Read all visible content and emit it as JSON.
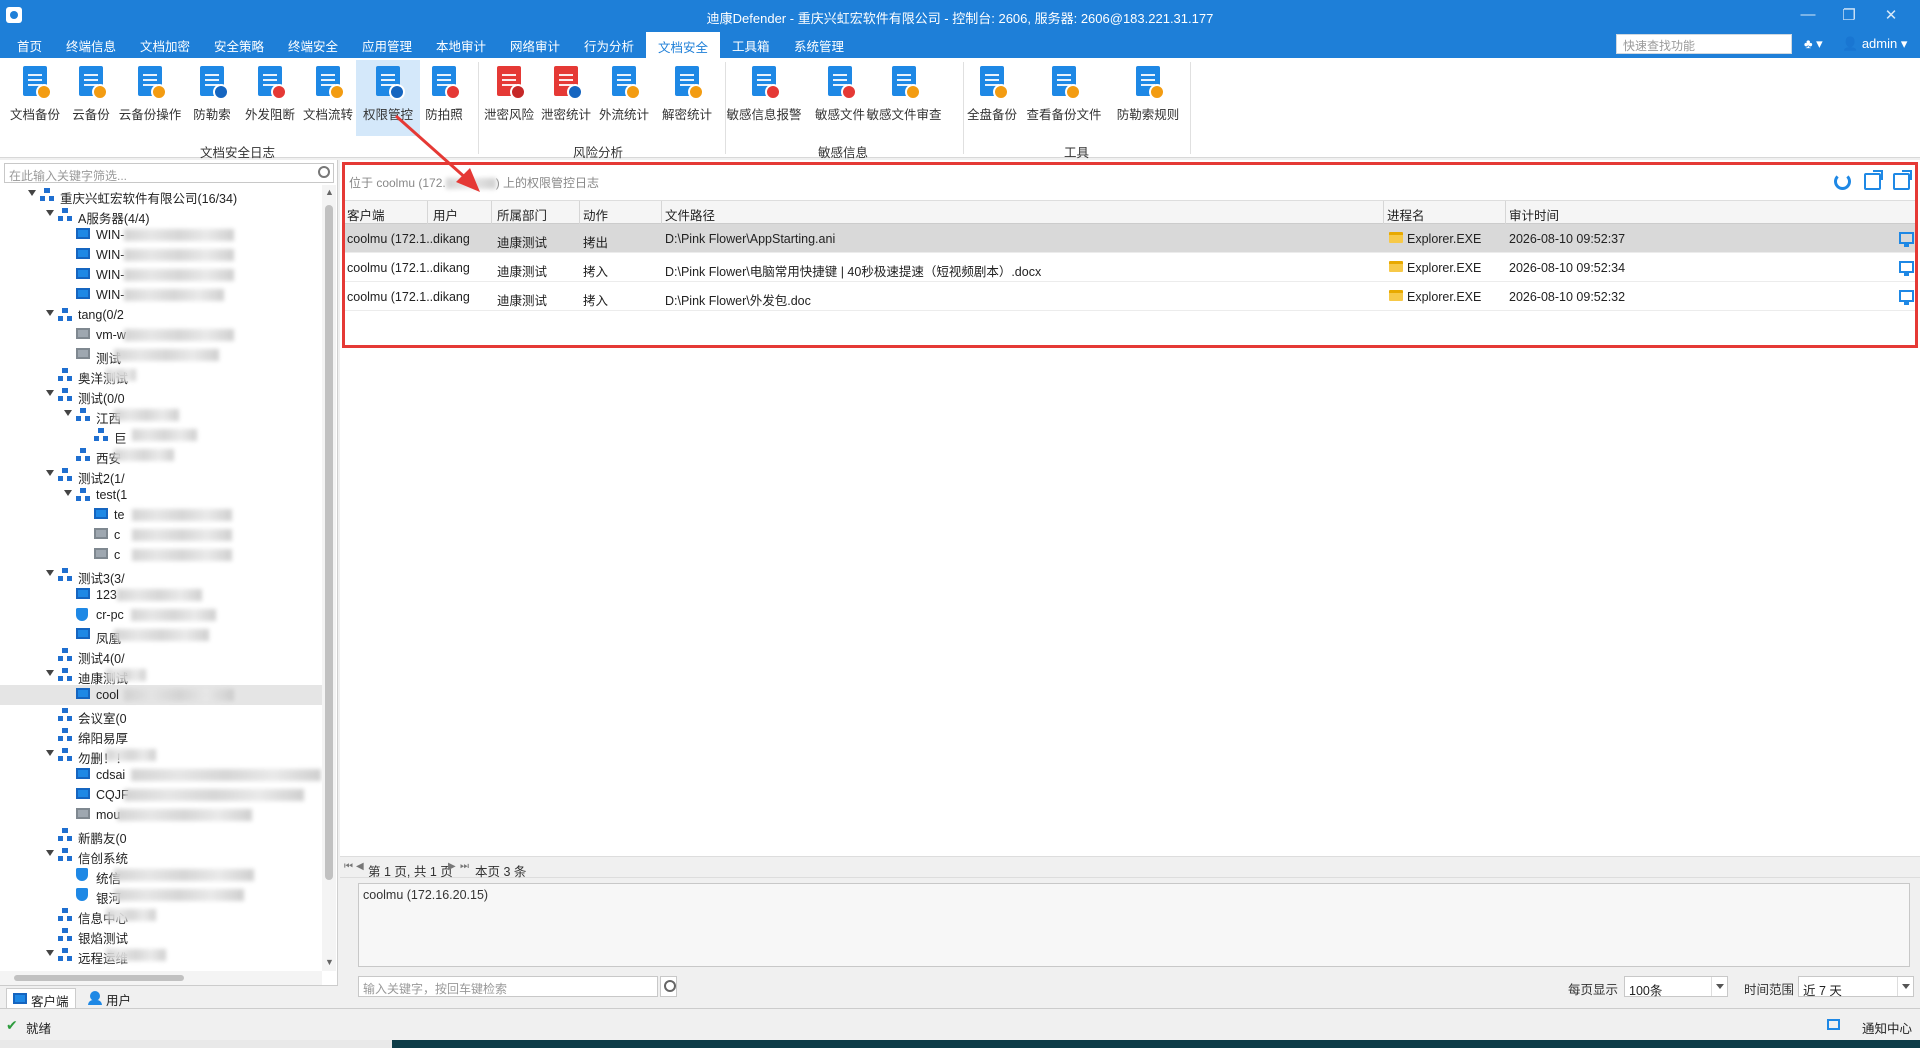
{
  "window": {
    "title": "迪康Defender - 重庆兴虹宏软件有限公司 - 控制台: 2606, 服务器: 2606@183.221.31.177",
    "controls": [
      "—",
      "❐",
      "✕"
    ]
  },
  "menu": {
    "items": [
      "首页",
      "终端信息",
      "文档加密",
      "安全策略",
      "终端安全",
      "应用管理",
      "本地审计",
      "网络审计",
      "行为分析",
      "文档安全",
      "工具箱",
      "系统管理"
    ],
    "active": "文档安全",
    "quick_search_placeholder": "快速查找功能",
    "admin_label": "admin",
    "org_menu": "▾"
  },
  "ribbon": {
    "buttons": [
      {
        "label": "文档备份",
        "icon": "doc-backup-icon",
        "color": "#1e88e5",
        "badge": "#f39c12"
      },
      {
        "label": "云备份",
        "icon": "cloud-backup-icon",
        "color": "#1e88e5",
        "badge": "#f39c12"
      },
      {
        "label": "云备份操作",
        "icon": "cloud-backup-op-icon",
        "color": "#1e88e5",
        "badge": "#f39c12"
      },
      {
        "label": "防勒索",
        "icon": "anti-ransom-icon",
        "color": "#1e88e5",
        "badge": "#1565c0"
      },
      {
        "label": "外发阻断",
        "icon": "send-block-icon",
        "color": "#1e88e5",
        "badge": "#e53935"
      },
      {
        "label": "文档流转",
        "icon": "doc-flow-icon",
        "color": "#1e88e5",
        "badge": "#f39c12"
      },
      {
        "label": "权限管控",
        "icon": "permission-control-icon",
        "color": "#1e88e5",
        "badge": "#1565c0"
      },
      {
        "label": "防拍照",
        "icon": "anti-photo-icon",
        "color": "#1e88e5",
        "badge": "#e53935"
      },
      {
        "label": "泄密风险",
        "icon": "leak-risk-icon",
        "color": "#e53935",
        "badge": "#c62828"
      },
      {
        "label": "泄密统计",
        "icon": "leak-stats-icon",
        "color": "#e53935",
        "badge": "#1565c0"
      },
      {
        "label": "外流统计",
        "icon": "outflow-stats-icon",
        "color": "#1e88e5",
        "badge": "#f39c12"
      },
      {
        "label": "解密统计",
        "icon": "decrypt-stats-icon",
        "color": "#1e88e5",
        "badge": "#f39c12"
      },
      {
        "label": "敏感信息报警",
        "icon": "sensitive-alarm-icon",
        "color": "#1e88e5",
        "badge": "#e53935"
      },
      {
        "label": "敏感文件",
        "icon": "sensitive-file-icon",
        "color": "#1e88e5",
        "badge": "#e53935"
      },
      {
        "label": "敏感文件审查",
        "icon": "sensitive-review-icon",
        "color": "#1e88e5",
        "badge": "#f39c12"
      },
      {
        "label": "全盘备份",
        "icon": "full-backup-icon",
        "color": "#1e88e5",
        "badge": "#f39c12"
      },
      {
        "label": "查看备份文件",
        "icon": "view-backup-icon",
        "color": "#1e88e5",
        "badge": "#f39c12"
      },
      {
        "label": "防勒索规则",
        "icon": "anti-ransom-rule-icon",
        "color": "#1e88e5",
        "badge": "#f39c12"
      }
    ],
    "groups": [
      "文档安全日志",
      "风险分析",
      "敏感信息",
      "工具"
    ],
    "active": "权限管控"
  },
  "left": {
    "filter_placeholder": "在此输入关键字筛选...",
    "tree": [
      {
        "text": "重庆兴虹宏软件有限公司(16/34)",
        "type": "org"
      },
      {
        "text": "A服务器(4/4)",
        "type": "org"
      },
      {
        "text": "WIN-",
        "type": "pc"
      },
      {
        "text": "WIN-",
        "type": "pc"
      },
      {
        "text": "WIN-",
        "type": "pc"
      },
      {
        "text": "WIN-",
        "type": "pc"
      },
      {
        "text": "tang(0/2",
        "type": "org"
      },
      {
        "text": "vm-w",
        "type": "pc-off"
      },
      {
        "text": "测试",
        "type": "pc-off"
      },
      {
        "text": "奥洋测试",
        "type": "org"
      },
      {
        "text": "测试(0/0",
        "type": "org"
      },
      {
        "text": "江西",
        "type": "org"
      },
      {
        "text": "巨",
        "type": "org"
      },
      {
        "text": "西安",
        "type": "org"
      },
      {
        "text": "测试2(1/",
        "type": "org"
      },
      {
        "text": "test(1",
        "type": "org"
      },
      {
        "text": "te",
        "type": "pc"
      },
      {
        "text": "c",
        "type": "pc-off"
      },
      {
        "text": "c",
        "type": "pc-off"
      },
      {
        "text": "测试3(3/",
        "type": "org"
      },
      {
        "text": "123",
        "type": "pc"
      },
      {
        "text": "cr-pc",
        "type": "shield"
      },
      {
        "text": "凤凰",
        "type": "pc"
      },
      {
        "text": "测试4(0/",
        "type": "org"
      },
      {
        "text": "迪康测试",
        "type": "org"
      },
      {
        "text": "cool",
        "type": "pc"
      },
      {
        "text": "会议室(0",
        "type": "org"
      },
      {
        "text": "绵阳易厚",
        "type": "org"
      },
      {
        "text": "勿删！！",
        "type": "org"
      },
      {
        "text": "cdsai",
        "type": "pc"
      },
      {
        "text": "CQJF",
        "type": "pc"
      },
      {
        "text": "mou",
        "type": "pc-off"
      },
      {
        "text": "新鹏友(0",
        "type": "org"
      },
      {
        "text": "信创系统",
        "type": "org"
      },
      {
        "text": "统信",
        "type": "shield"
      },
      {
        "text": "银河",
        "type": "shield"
      },
      {
        "text": "信息中心",
        "type": "org"
      },
      {
        "text": "银焰测试",
        "type": "org"
      },
      {
        "text": "远程运维",
        "type": "org"
      }
    ],
    "tabs": [
      "客户端",
      "用户"
    ]
  },
  "main": {
    "title_prefix": "位于 coolmu (172.",
    "title_suffix": ") 上的权限管控日志",
    "columns": [
      "客户端",
      "用户",
      "所属部门",
      "动作",
      "文件路径",
      "进程名",
      "审计时间"
    ],
    "rows": [
      {
        "client": "coolmu (172.1...",
        "user": "dikang",
        "dept": "迪康测试",
        "action": "拷出",
        "path": "D:\\Pink Flower\\AppStarting.ani",
        "process": "Explorer.EXE",
        "time": "2026-08-10 09:52:37"
      },
      {
        "client": "coolmu (172.1...",
        "user": "dikang",
        "dept": "迪康测试",
        "action": "拷入",
        "path": "D:\\Pink Flower\\电脑常用快捷键 | 40秒极速提速（短视频剧本）.docx",
        "process": "Explorer.EXE",
        "time": "2026-08-10 09:52:34"
      },
      {
        "client": "coolmu (172.1...",
        "user": "dikang",
        "dept": "迪康测试",
        "action": "拷入",
        "path": "D:\\Pink Flower\\外发包.doc",
        "process": "Explorer.EXE",
        "time": "2026-08-10 09:52:32"
      }
    ],
    "pager": {
      "page_text": "第 1 页, 共 1 页",
      "count_text": "本页 3 条"
    },
    "detail_text": "coolmu (172.16.20.15)",
    "search_placeholder": "输入关键字，按回车键检索",
    "per_page_label": "每页显示",
    "per_page_value": "100条",
    "time_range_label": "时间范围",
    "time_range_value": "近 7 天"
  },
  "status": {
    "text": "就绪",
    "notify": "通知中心"
  },
  "colors": {
    "accent": "#1e7fd8",
    "highlight": "#e53935"
  }
}
